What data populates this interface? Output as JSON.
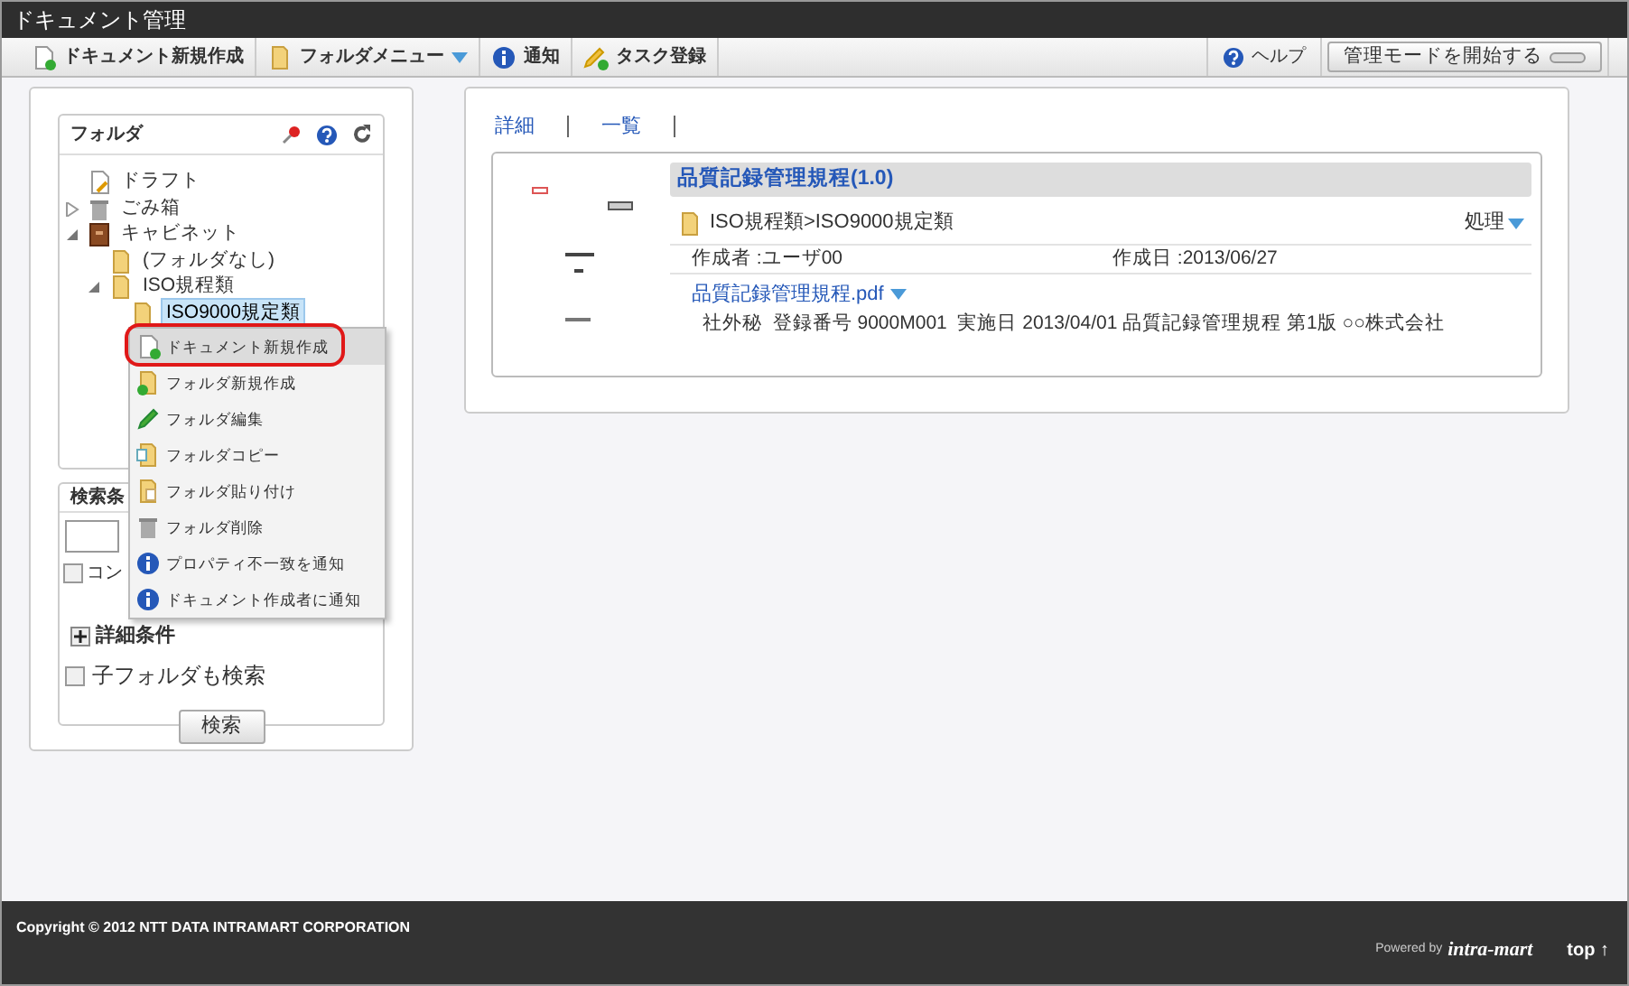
{
  "window": {
    "title": "ドキュメント管理"
  },
  "toolbar": {
    "left": [
      {
        "kind": "doc",
        "label": "ドキュメント新規作成",
        "dropdown": false
      },
      {
        "kind": "folder",
        "label": "フォルダメニュー",
        "dropdown": true
      },
      {
        "kind": "info",
        "label": "通知",
        "dropdown": false
      },
      {
        "kind": "task",
        "label": "タスク登録",
        "dropdown": false
      }
    ],
    "help": "ヘルプ",
    "admin_button": "管理モードを開始する",
    "admin_on": false
  },
  "folder_panel": {
    "title": "フォルダ",
    "tree": [
      {
        "kind": "draft",
        "label": "ドラフト",
        "selected": false
      },
      {
        "kind": "trash",
        "label": "ごみ箱",
        "expanded": false,
        "selected": false
      },
      {
        "kind": "cabinet",
        "label": "キャビネット",
        "expanded": true,
        "selected": false,
        "children": [
          {
            "kind": "folder",
            "label": "(フォルダなし)",
            "selected": false
          },
          {
            "kind": "folder",
            "label": "ISO規程類",
            "expanded": true,
            "selected": false,
            "children": [
              {
                "kind": "folder",
                "label": "ISO9000規定類",
                "selected": true
              }
            ]
          }
        ]
      }
    ]
  },
  "context_menu": [
    {
      "kind": "doc",
      "label": "ドキュメント新規作成",
      "selected": true
    },
    {
      "kind": "folder-new",
      "label": "フォルダ新規作成",
      "selected": false
    },
    {
      "kind": "pencil",
      "label": "フォルダ編集",
      "selected": false
    },
    {
      "kind": "folder-copy",
      "label": "フォルダコピー",
      "selected": false
    },
    {
      "kind": "folder-paste",
      "label": "フォルダ貼り付け",
      "selected": false
    },
    {
      "kind": "trash",
      "label": "フォルダ削除",
      "selected": false
    },
    {
      "kind": "info",
      "label": "プロパティ不一致を通知",
      "selected": false
    },
    {
      "kind": "info",
      "label": "ドキュメント作成者に通知",
      "selected": false
    }
  ],
  "search_panel": {
    "title": "検索条",
    "content_checkbox": {
      "label": "コン",
      "checked": false
    },
    "detail_button": "詳細条件",
    "subfolder_checkbox": {
      "label": "子フォルダも検索",
      "checked": false
    },
    "search_button": "検索"
  },
  "view_tabs": [
    {
      "label": "詳細",
      "selected": false
    },
    {
      "label": "一覧",
      "selected": false
    }
  ],
  "document": {
    "title": "品質記録管理規程(1.0)",
    "path": "ISO規程類>ISO9000規定類",
    "action": "処理",
    "author": "作成者 :ユーザ00",
    "created": "作成日 :2013/06/27",
    "file": "品質記録管理規程.pdf",
    "summary": "社外秘  登録番号 9000M001  実施日 2013/04/01 品質記録管理規程 第1版 ○○株式会社"
  },
  "footer": {
    "copyright": "Copyright © 2012 NTT DATA INTRAMART CORPORATION",
    "powered_by": "Powered by",
    "brand": "intra-mart",
    "top_link": "top ↑"
  }
}
